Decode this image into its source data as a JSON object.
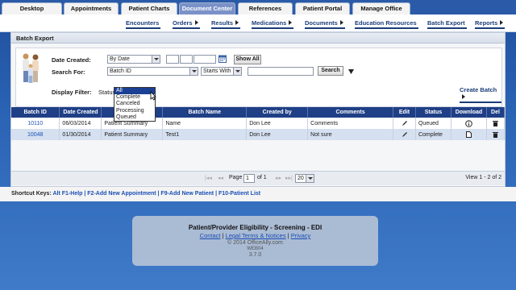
{
  "top_tabs": [
    {
      "label": "Desktop"
    },
    {
      "label": "Appointments"
    },
    {
      "label": "Patient Charts"
    },
    {
      "label": "Document Center"
    },
    {
      "label": "References"
    },
    {
      "label": "Patient Portal"
    },
    {
      "label": "Manage Office"
    }
  ],
  "sub_nav": [
    {
      "label": "Encounters"
    },
    {
      "label": "Orders"
    },
    {
      "label": "Results"
    },
    {
      "label": "Medications"
    },
    {
      "label": "Documents"
    },
    {
      "label": "Education Resources"
    },
    {
      "label": "Batch Export"
    },
    {
      "label": "Reports"
    }
  ],
  "panel": {
    "title": "Batch Export",
    "date_created_label": "Date Created:",
    "date_created_value": "By Date",
    "show_all_label": "Show All",
    "search_for_label": "Search For:",
    "search_for_value": "Batch ID",
    "match_value": "Starts With",
    "search_button": "Search",
    "display_filter_label": "Display Filter:",
    "status_label": "Status:",
    "create_batch_label": "Create Batch",
    "status_options": [
      "All",
      "Complete",
      "Canceled",
      "Processing",
      "Queued"
    ]
  },
  "table": {
    "headers": [
      "Batch ID",
      "Date Created",
      "",
      "Batch Name",
      "Created by",
      "Comments",
      "Edit",
      "Status",
      "Download",
      "Del"
    ],
    "rows": [
      {
        "batch_id": "10110",
        "date": "06/03/2014",
        "type": "Patient Summary",
        "name": "Name",
        "created_by": "Don Lee",
        "comments": "Comments",
        "status": "Queued"
      },
      {
        "batch_id": "10048",
        "date": "01/30/2014",
        "type": "Patient Summary",
        "name": "Test1",
        "created_by": "Don Lee",
        "comments": "Not sure",
        "status": "Complete"
      }
    ]
  },
  "pager": {
    "page_label": "Page",
    "page_value": "1",
    "of_label": "of 1",
    "per_page": "20",
    "view_text": "View 1 - 2 of 2"
  },
  "shortcut": {
    "prefix": "Shortcut Keys:",
    "keys": "Alt F1-Help | F2-Add New Appointment | F9-Add New Patient | F10-Patient List"
  },
  "footer": {
    "title": "Patient/Provider Eligibility - Screening - EDI",
    "contact": "Contact",
    "legal": "Legal Terms & Notices",
    "privacy": "Privacy",
    "copyright": "© 2014 OfficeAlly.com",
    "server": "WEB04",
    "version": "3.7.0"
  },
  "colors": {
    "header_blue": "#1f3f86",
    "active_tab": "#7b92c8",
    "link": "#1b4fb3",
    "background": "#2b63b5"
  }
}
